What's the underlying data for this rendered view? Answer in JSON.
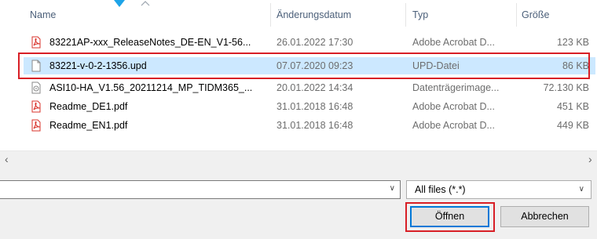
{
  "columns": {
    "name": "Name",
    "date": "Änderungsdatum",
    "type": "Typ",
    "size": "Größe"
  },
  "files": [
    {
      "name": "83221AP-xxx_ReleaseNotes_DE-EN_V1-56...",
      "date": "26.01.2022 17:30",
      "type": "Adobe Acrobat D...",
      "size": "123 KB",
      "icon": "pdf-icon"
    },
    {
      "name": "83221-v-0-2-1356.upd",
      "date": "07.07.2020 09:23",
      "type": "UPD-Datei",
      "size": "86 KB",
      "icon": "file-icon"
    },
    {
      "name": "ASI10-HA_V1.56_20211214_MP_TIDM365_...",
      "date": "20.01.2022 14:34",
      "type": "Datenträgerimage...",
      "size": "72.130 KB",
      "icon": "disk-image-icon"
    },
    {
      "name": "Readme_DE1.pdf",
      "date": "31.01.2018 16:48",
      "type": "Adobe Acrobat D...",
      "size": "451 KB",
      "icon": "pdf-icon"
    },
    {
      "name": "Readme_EN1.pdf",
      "date": "31.01.2018 16:48",
      "type": "Adobe Acrobat D...",
      "size": "449 KB",
      "icon": "pdf-icon"
    }
  ],
  "selected_row": 1,
  "filename": {
    "value": ""
  },
  "filter": {
    "selected": "All files (*.*)"
  },
  "buttons": {
    "open": "Öffnen",
    "cancel": "Abbrechen"
  },
  "colors": {
    "selection": "#cce8ff",
    "highlight_outline": "#d81f26",
    "pdf_red": "#d9332b",
    "marker": "#1ea4e8"
  }
}
